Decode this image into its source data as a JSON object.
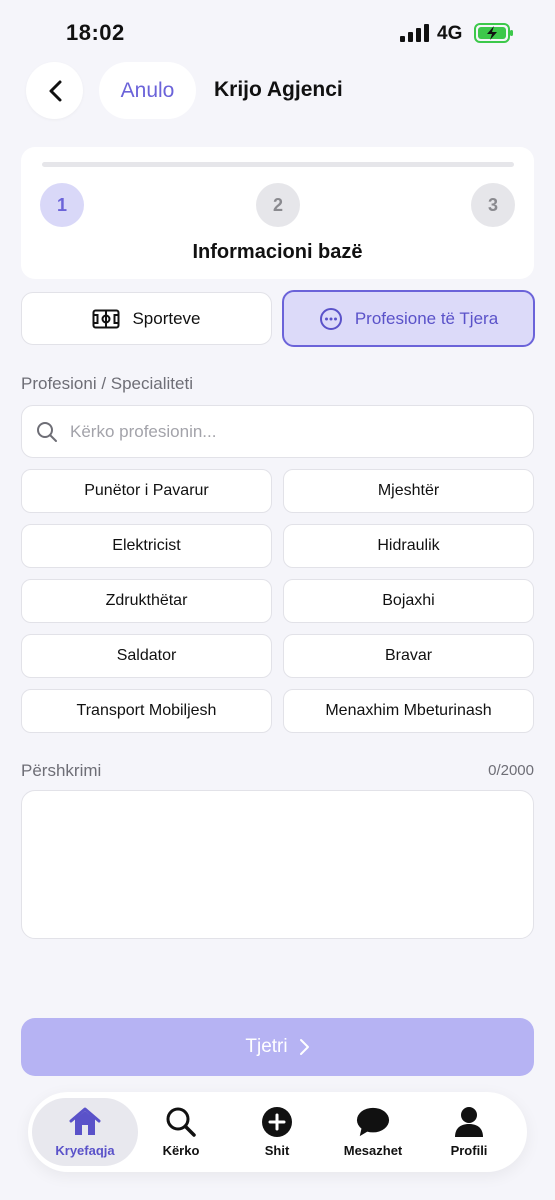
{
  "status_bar": {
    "time": "18:02",
    "network": "4G"
  },
  "header": {
    "cancel_label": "Anulo",
    "title": "Krijo Agjenci"
  },
  "stepper": {
    "steps": [
      "1",
      "2",
      "3"
    ],
    "current_step": 1,
    "current_label": "Informacioni bazë"
  },
  "categories": [
    {
      "label": "Sporteve",
      "icon": "soccer-field-icon",
      "selected": false
    },
    {
      "label": "Profesione të Tjera",
      "icon": "ellipsis-circle-icon",
      "selected": true
    }
  ],
  "profession": {
    "label": "Profesioni / Specialiteti",
    "search_placeholder": "Kërko profesionin...",
    "options": [
      "Punëtor i Pavarur",
      "Mjeshtër",
      "Elektricist",
      "Hidraulik",
      "Zdrukthëtar",
      "Bojaxhi",
      "Saldator",
      "Bravar",
      "Transport Mobiljesh",
      "Menaxhim Mbeturinash"
    ]
  },
  "description": {
    "label": "Përshkrimi",
    "counter": "0/2000"
  },
  "next_button": {
    "label": "Tjetri"
  },
  "bottom_nav": {
    "items": [
      {
        "label": "Kryefaqja",
        "icon": "home-icon",
        "active": true
      },
      {
        "label": "Kërko",
        "icon": "search-icon",
        "active": false
      },
      {
        "label": "Shit",
        "icon": "plus-circle-icon",
        "active": false
      },
      {
        "label": "Mesazhet",
        "icon": "chat-bubble-icon",
        "active": false
      },
      {
        "label": "Profili",
        "icon": "person-icon",
        "active": false
      }
    ]
  },
  "colors": {
    "accent": "#6b63d9",
    "accent_light": "#dcdaf9",
    "next_disabled": "#b6b3f3",
    "background": "#f5f5fa"
  }
}
